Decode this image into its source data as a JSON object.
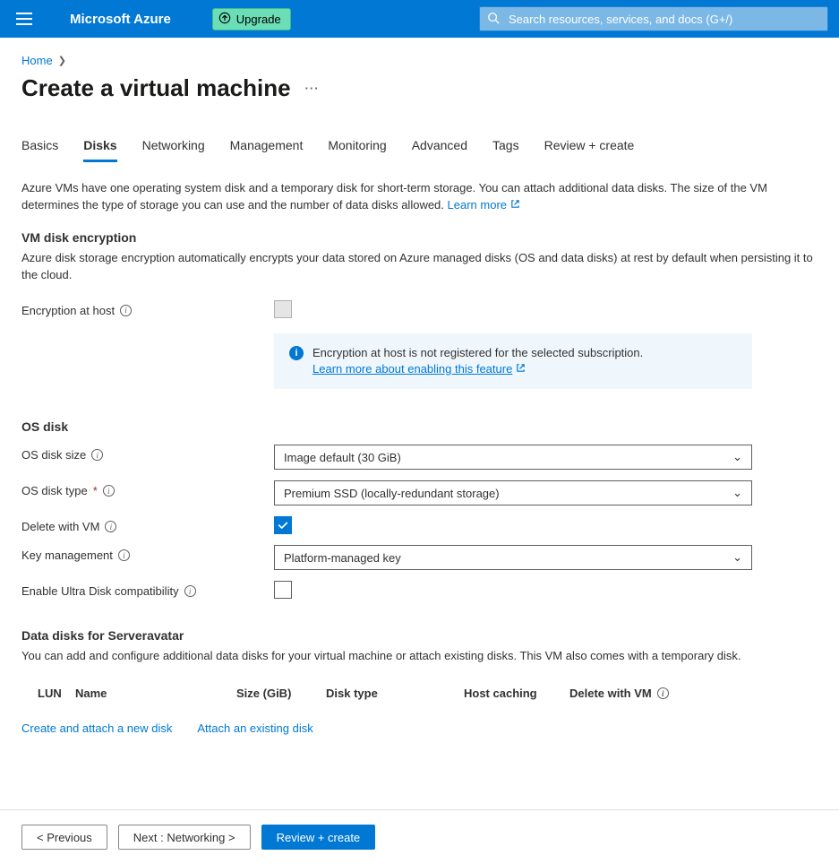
{
  "header": {
    "brand": "Microsoft Azure",
    "upgrade_label": "Upgrade",
    "search_placeholder": "Search resources, services, and docs (G+/)"
  },
  "breadcrumb": {
    "home": "Home"
  },
  "page": {
    "title": "Create a virtual machine"
  },
  "tabs": [
    {
      "label": "Basics"
    },
    {
      "label": "Disks",
      "active": true
    },
    {
      "label": "Networking"
    },
    {
      "label": "Management"
    },
    {
      "label": "Monitoring"
    },
    {
      "label": "Advanced"
    },
    {
      "label": "Tags"
    },
    {
      "label": "Review + create"
    }
  ],
  "intro": {
    "text": "Azure VMs have one operating system disk and a temporary disk for short-term storage. You can attach additional data disks. The size of the VM determines the type of storage you can use and the number of data disks allowed.",
    "learn_more": "Learn more"
  },
  "sections": {
    "encryption": {
      "title": "VM disk encryption",
      "desc": "Azure disk storage encryption automatically encrypts your data stored on Azure managed disks (OS and data disks) at rest by default when persisting it to the cloud.",
      "host_label": "Encryption at host",
      "callout_text": "Encryption at host is not registered for the selected subscription.",
      "callout_link": "Learn more about enabling this feature"
    },
    "osdisk": {
      "title": "OS disk",
      "size_label": "OS disk size",
      "size_value": "Image default (30 GiB)",
      "type_label": "OS disk type",
      "type_value": "Premium SSD (locally-redundant storage)",
      "delete_label": "Delete with VM",
      "keymgmt_label": "Key management",
      "keymgmt_value": "Platform-managed key",
      "ultra_label": "Enable Ultra Disk compatibility"
    },
    "datadisks": {
      "title": "Data disks for Serveravatar",
      "desc": "You can add and configure additional data disks for your virtual machine or attach existing disks. This VM also comes with a temporary disk.",
      "cols": {
        "lun": "LUN",
        "name": "Name",
        "size": "Size (GiB)",
        "type": "Disk type",
        "cache": "Host caching",
        "delete": "Delete with VM"
      },
      "create_link": "Create and attach a new disk",
      "attach_link": "Attach an existing disk"
    }
  },
  "footer": {
    "prev": "< Previous",
    "next": "Next : Networking >",
    "review": "Review + create"
  }
}
